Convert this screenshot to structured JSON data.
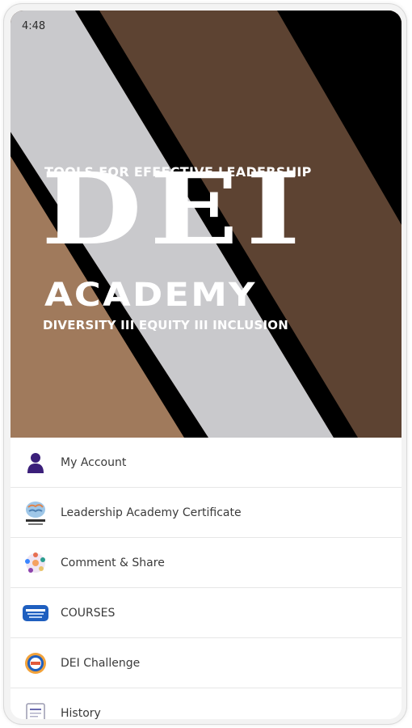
{
  "status_bar": {
    "time": "4:48"
  },
  "hero": {
    "subtitle": "TOOLS FOR EFFECTIVE LEADERSHIP",
    "title": "DEI",
    "academy": "ACADEMY",
    "tagline": "DIVERSITY III EQUITY III INCLUSION",
    "colors": {
      "dark_brown": "#5d4332",
      "tan": "#a07a5c",
      "light_gray": "#c9c9cc",
      "black": "#000000"
    }
  },
  "menu": {
    "items": [
      {
        "label": "My Account",
        "icon": "person-icon"
      },
      {
        "label": "Leadership Academy Certificate",
        "icon": "brain-certificate-icon"
      },
      {
        "label": "Comment & Share",
        "icon": "share-circle-icon"
      },
      {
        "label": "COURSES",
        "icon": "courses-badge-icon"
      },
      {
        "label": "DEI Challenge",
        "icon": "challenge-medal-icon"
      },
      {
        "label": "History",
        "icon": "history-document-icon"
      }
    ]
  }
}
